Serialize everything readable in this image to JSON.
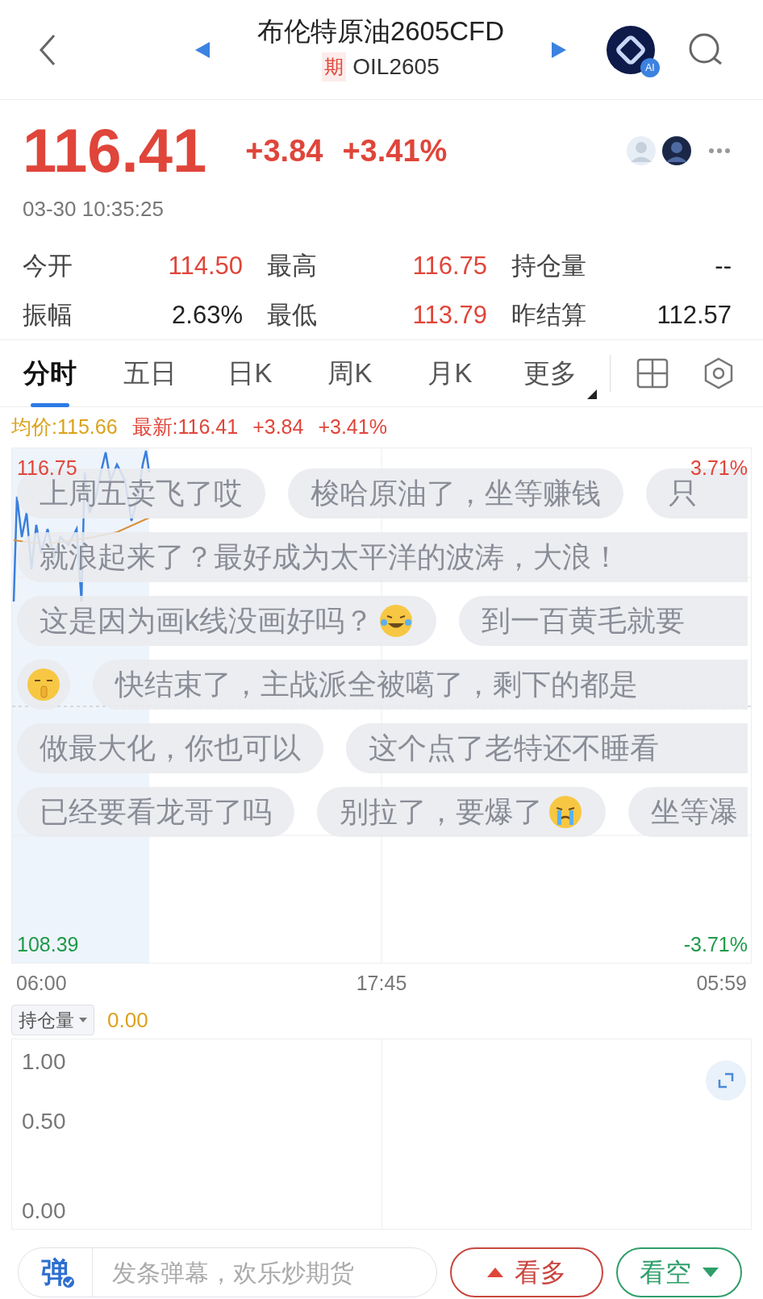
{
  "header": {
    "title": "布伦特原油2605CFD",
    "badge": "期",
    "code": "OIL2605",
    "ai_badge": "AI"
  },
  "quote": {
    "price": "116.41",
    "change": "+3.84",
    "change_pct": "+3.41%",
    "color": "#e0453a",
    "time": "03-30 10:35:25"
  },
  "stats": [
    {
      "label": "今开",
      "value": "114.50",
      "color": "#e0453a"
    },
    {
      "label": "最高",
      "value": "116.75",
      "color": "#e0453a"
    },
    {
      "label": "持仓量",
      "value": "--",
      "color": "#222222"
    },
    {
      "label": "振幅",
      "value": "2.63%",
      "color": "#222222"
    },
    {
      "label": "最低",
      "value": "113.79",
      "color": "#e0453a"
    },
    {
      "label": "昨结算",
      "value": "112.57",
      "color": "#222222"
    }
  ],
  "tabs": [
    {
      "label": "分时",
      "selected": true,
      "has_menu": false
    },
    {
      "label": "五日",
      "selected": false,
      "has_menu": false
    },
    {
      "label": "日K",
      "selected": false,
      "has_menu": false
    },
    {
      "label": "周K",
      "selected": false,
      "has_menu": false
    },
    {
      "label": "月K",
      "selected": false,
      "has_menu": false
    },
    {
      "label": "更多",
      "selected": false,
      "has_menu": true
    }
  ],
  "summary": [
    {
      "text": "均价:115.66",
      "color": "#dba21c"
    },
    {
      "text": "最新:116.41",
      "color": "#e0453a"
    },
    {
      "text": "+3.84",
      "color": "#e0453a"
    },
    {
      "text": "+3.41%",
      "color": "#e0453a"
    }
  ],
  "chart": {
    "price_axis": {
      "high": "116.75",
      "low": "108.39"
    },
    "percent_axis": {
      "high": "3.71%",
      "low": "-3.71%"
    },
    "time_axis": [
      "06:00",
      "17:45",
      "05:59"
    ]
  },
  "danmaku": [
    [
      {
        "kind": "plain",
        "text": "上周五卖飞了哎"
      },
      {
        "kind": "plain",
        "text": "梭哈原油了，坐等赚钱"
      },
      {
        "kind": "plain",
        "text": "只"
      }
    ],
    [
      {
        "kind": "plain",
        "text": "就浪起来了？最好成为太平洋的波涛，大浪！"
      }
    ],
    [
      {
        "kind": "laugh",
        "text": "这是因为画k线没画好吗？"
      },
      {
        "kind": "plain",
        "text": "到一百黄毛就要"
      }
    ],
    [
      {
        "kind": "shush"
      },
      {
        "kind": "plain",
        "text": "快结束了，主战派全被噶了，剩下的都是"
      }
    ],
    [
      {
        "kind": "plain",
        "text": "做最大化，你也可以"
      },
      {
        "kind": "plain",
        "text": "这个点了老特还不睡看"
      }
    ],
    [
      {
        "kind": "plain",
        "text": "已经要看龙哥了吗"
      },
      {
        "kind": "cry",
        "text": "别拉了，要爆了"
      },
      {
        "kind": "plain",
        "text": "坐等瀑"
      }
    ]
  ],
  "open_interest": {
    "selector": "持仓量",
    "value": "0.00",
    "axis": [
      "1.00",
      "0.50",
      "0.00"
    ]
  },
  "bottom_bar": {
    "icon_text": "弹",
    "placeholder": "发条弹幕，欢乐炒期货",
    "bull": "看多",
    "bear": "看空"
  }
}
